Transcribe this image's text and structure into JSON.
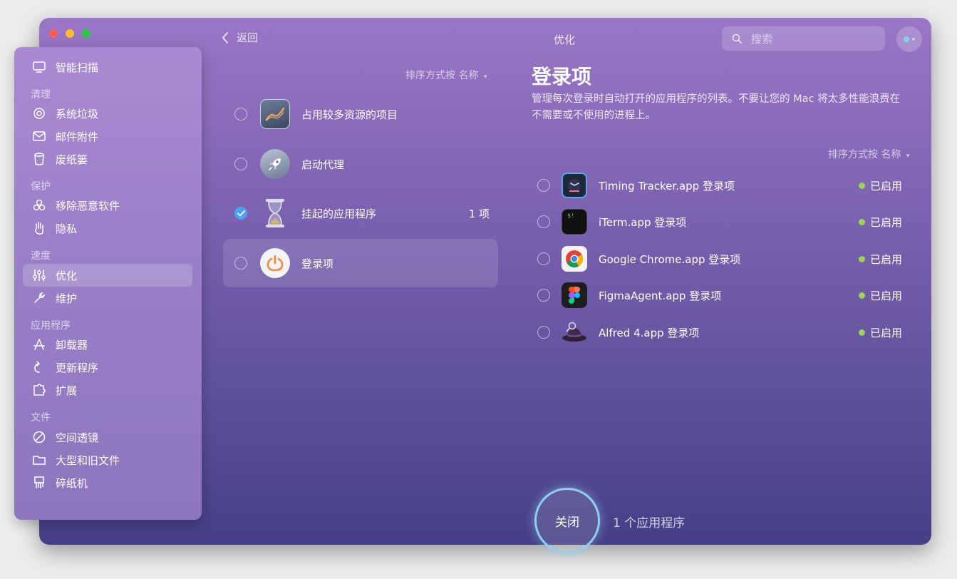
{
  "window": {
    "traffic_lights": {
      "close_color": "#ff5f57",
      "minimize_color": "#febc2e",
      "zoom_color": "#28c840"
    }
  },
  "toolbar": {
    "back_label": "返回",
    "title": "优化",
    "search_placeholder": "搜索"
  },
  "sidebar": {
    "items": [
      {
        "label": "智能扫描",
        "icon": "monitor-icon"
      },
      {
        "section": "清理"
      },
      {
        "label": "系统垃圾",
        "icon": "swirl-icon"
      },
      {
        "label": "邮件附件",
        "icon": "envelope-icon"
      },
      {
        "label": "废纸篓",
        "icon": "trash-icon"
      },
      {
        "section": "保护"
      },
      {
        "label": "移除恶意软件",
        "icon": "biohazard-icon"
      },
      {
        "label": "隐私",
        "icon": "hand-icon"
      },
      {
        "section": "速度"
      },
      {
        "label": "优化",
        "icon": "sliders-icon",
        "active": true
      },
      {
        "label": "维护",
        "icon": "wrench-icon"
      },
      {
        "section": "应用程序"
      },
      {
        "label": "卸载器",
        "icon": "apps-icon"
      },
      {
        "label": "更新程序",
        "icon": "update-arrow-icon"
      },
      {
        "label": "扩展",
        "icon": "puzzle-icon"
      },
      {
        "section": "文件"
      },
      {
        "label": "空间透镜",
        "icon": "lens-icon"
      },
      {
        "label": "大型和旧文件",
        "icon": "folder-icon"
      },
      {
        "label": "碎纸机",
        "icon": "shredder-icon"
      }
    ]
  },
  "categories": {
    "sort_label": "排序方式按 名称",
    "items": [
      {
        "label": "占用较多资源的项目",
        "icon": "chart-icon",
        "checked": false,
        "count": ""
      },
      {
        "label": "启动代理",
        "icon": "rocket-icon",
        "checked": false,
        "count": ""
      },
      {
        "label": "挂起的应用程序",
        "icon": "hourglass-icon",
        "checked": true,
        "count": "1 项"
      },
      {
        "label": "登录项",
        "icon": "power-icon",
        "checked": false,
        "count": "",
        "selected": true
      }
    ]
  },
  "detail": {
    "title": "登录项",
    "description": "管理每次登录时自动打开的应用程序的列表。不要让您的 Mac 将太多性能浪费在不需要或不使用的进程上。",
    "sort_label": "排序方式按 名称",
    "status_color": "#9ad25a",
    "items": [
      {
        "label": "Timing Tracker.app 登录项",
        "status": "已启用",
        "icon": "timing-clock-icon"
      },
      {
        "label": "iTerm.app 登录项",
        "status": "已启用",
        "icon": "terminal-icon"
      },
      {
        "label": "Google Chrome.app 登录项",
        "status": "已启用",
        "icon": "chrome-icon"
      },
      {
        "label": "FigmaAgent.app 登录项",
        "status": "已启用",
        "icon": "figma-icon"
      },
      {
        "label": "Alfred 4.app 登录项",
        "status": "已启用",
        "icon": "alfred-hat-icon"
      }
    ]
  },
  "footer": {
    "close_label": "关闭",
    "summary": "1 个应用程序"
  }
}
